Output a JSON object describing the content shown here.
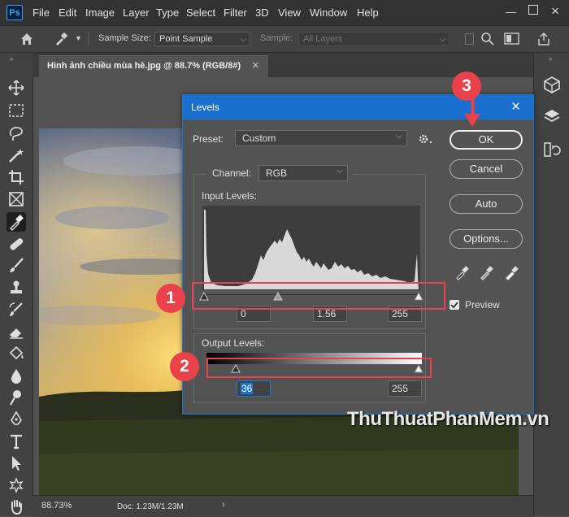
{
  "app": {
    "logo": "Ps"
  },
  "menu": [
    "File",
    "Edit",
    "Image",
    "Layer",
    "Type",
    "Select",
    "Filter",
    "3D",
    "View",
    "Window",
    "Help"
  ],
  "options_bar": {
    "sample_size_label": "Sample Size:",
    "sample_size_value": "Point Sample",
    "sample_label": "Sample:",
    "sample_value": "All Layers"
  },
  "document_tab": {
    "title": "Hình ảnh chiều mùa hè.jpg @ 88.7% (RGB/8#)",
    "close": "×"
  },
  "status": {
    "zoom": "88.73%",
    "doc": "Doc: 1.23M/1.23M"
  },
  "dialog": {
    "title": "Levels",
    "preset_label": "Preset:",
    "preset_value": "Custom",
    "channel_label": "Channel:",
    "channel_value": "RGB",
    "input_levels_label": "Input Levels:",
    "input_black": "0",
    "input_gamma": "1.56",
    "input_white": "255",
    "output_levels_label": "Output Levels:",
    "output_black": "36",
    "output_white": "255",
    "buttons": {
      "ok": "OK",
      "cancel": "Cancel",
      "auto": "Auto",
      "options": "Options..."
    },
    "preview_label": "Preview",
    "preview_checked": true
  },
  "annotations": {
    "step1": "1",
    "step2": "2",
    "step3": "3"
  },
  "watermark": "ThuThuatPhanMem.vn",
  "colors": {
    "accent": "#1b6fcf",
    "annotation_red": "#e9424a"
  }
}
